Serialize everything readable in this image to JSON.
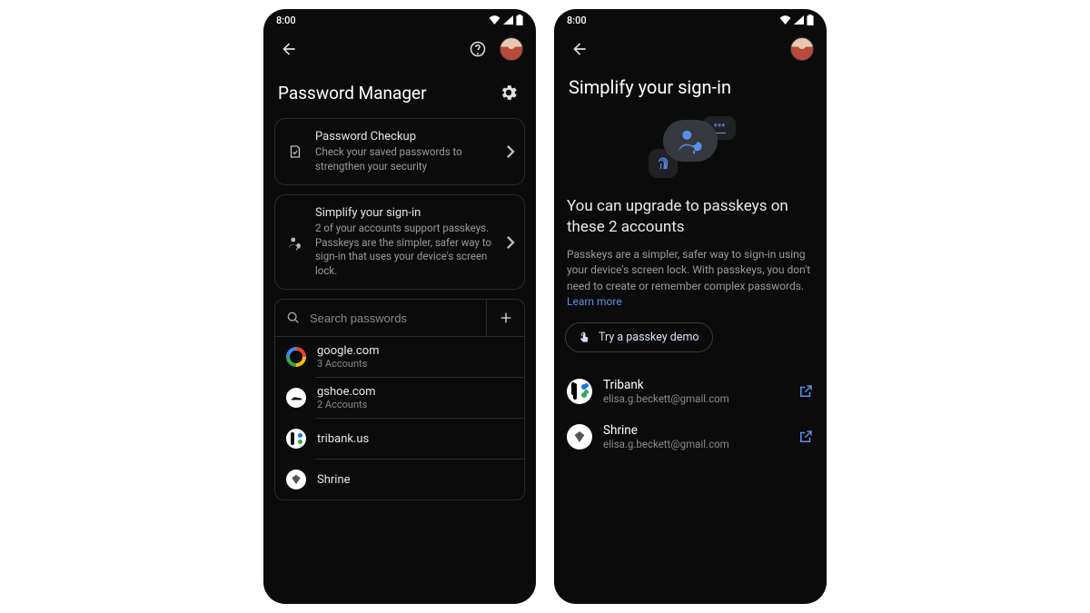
{
  "status": {
    "time": "8:00"
  },
  "phone1": {
    "title": "Password Manager",
    "cards": [
      {
        "title": "Password Checkup",
        "subtitle": "Check your saved passwords to strengthen your security"
      },
      {
        "title": "Simplify your sign-in",
        "subtitle": "2 of your accounts support passkeys. Passkeys are the simpler, safer way to sign-in that uses your device's screen lock."
      }
    ],
    "search_placeholder": "Search passwords",
    "sites": [
      {
        "name": "google.com",
        "sub": "3 Accounts"
      },
      {
        "name": "gshoe.com",
        "sub": "2 Accounts"
      },
      {
        "name": "tribank.us",
        "sub": ""
      },
      {
        "name": "Shrine",
        "sub": ""
      }
    ]
  },
  "phone2": {
    "title": "Simplify your sign-in",
    "heading": "You can upgrade to passkeys on these 2 accounts",
    "body": "Passkeys are a simpler, safer way to sign-in using your device's screen lock. With passkeys, you don't need to create or remember complex passwords. ",
    "learn_more": "Learn more",
    "demo_label": "Try a passkey demo",
    "accounts": [
      {
        "name": "Tribank",
        "email": "elisa.g.beckett@gmail.com"
      },
      {
        "name": "Shrine",
        "email": "elisa.g.beckett@gmail.com"
      }
    ]
  }
}
